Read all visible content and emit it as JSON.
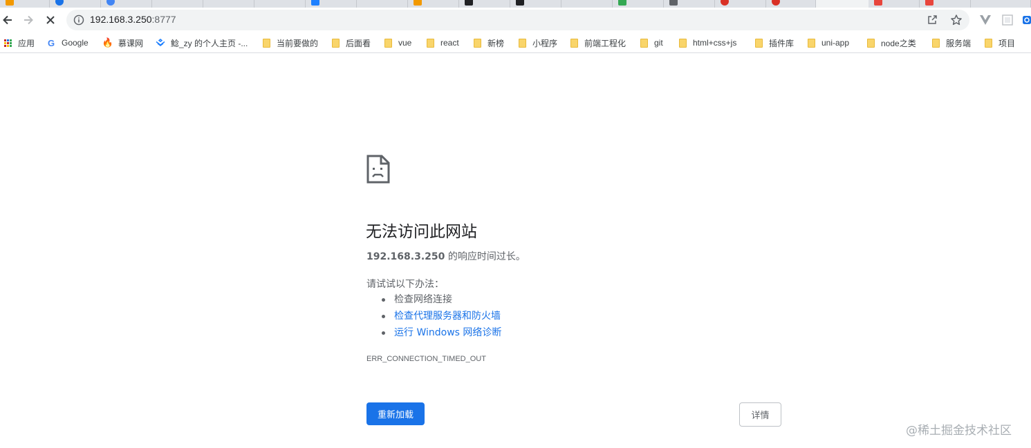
{
  "colors": {
    "accent": "#1a73e8",
    "toolbar_bg": "#f1f3f4",
    "text_secondary": "#5f6368"
  },
  "toolbar": {
    "url_host": "192.168.3.250",
    "url_port": ":8777",
    "back_icon": "arrow-left-icon",
    "forward_icon": "arrow-right-icon",
    "stop_icon": "close-icon",
    "info_icon": "info-icon",
    "share_icon": "share-icon",
    "star_icon": "star-icon"
  },
  "bookmarks": [
    {
      "label": "应用",
      "icon": "apps-grid-icon"
    },
    {
      "label": "Google",
      "icon": "google-icon"
    },
    {
      "label": "慕课网",
      "icon": "imooc-icon"
    },
    {
      "label": "鯰_zy 的个人主页 -...",
      "icon": "juejin-icon"
    },
    {
      "label": "当前要做的",
      "icon": "folder-icon"
    },
    {
      "label": "后面看",
      "icon": "folder-icon"
    },
    {
      "label": "vue",
      "icon": "folder-icon"
    },
    {
      "label": "react",
      "icon": "folder-icon"
    },
    {
      "label": "新榜",
      "icon": "folder-icon"
    },
    {
      "label": "小程序",
      "icon": "folder-icon"
    },
    {
      "label": "前端工程化",
      "icon": "folder-icon"
    },
    {
      "label": "git",
      "icon": "folder-icon"
    },
    {
      "label": "html+css+js",
      "icon": "folder-icon"
    },
    {
      "label": "插件库",
      "icon": "folder-icon"
    },
    {
      "label": "uni-app",
      "icon": "folder-icon"
    },
    {
      "label": "node之类",
      "icon": "folder-icon"
    },
    {
      "label": "服务端",
      "icon": "folder-icon"
    },
    {
      "label": "项目",
      "icon": "folder-icon"
    }
  ],
  "error": {
    "title": "无法访问此网站",
    "host": "192.168.3.250",
    "desc_suffix": " 的响应时间过长。",
    "try_label": "请试试以下办法：",
    "suggestions": [
      "检查网络连接",
      "检查代理服务器和防火墙",
      "运行 Windows 网络诊断"
    ],
    "code": "ERR_CONNECTION_TIMED_OUT",
    "reload_label": "重新加载",
    "details_label": "详情"
  },
  "watermark": "@稀土掘金技术社区"
}
